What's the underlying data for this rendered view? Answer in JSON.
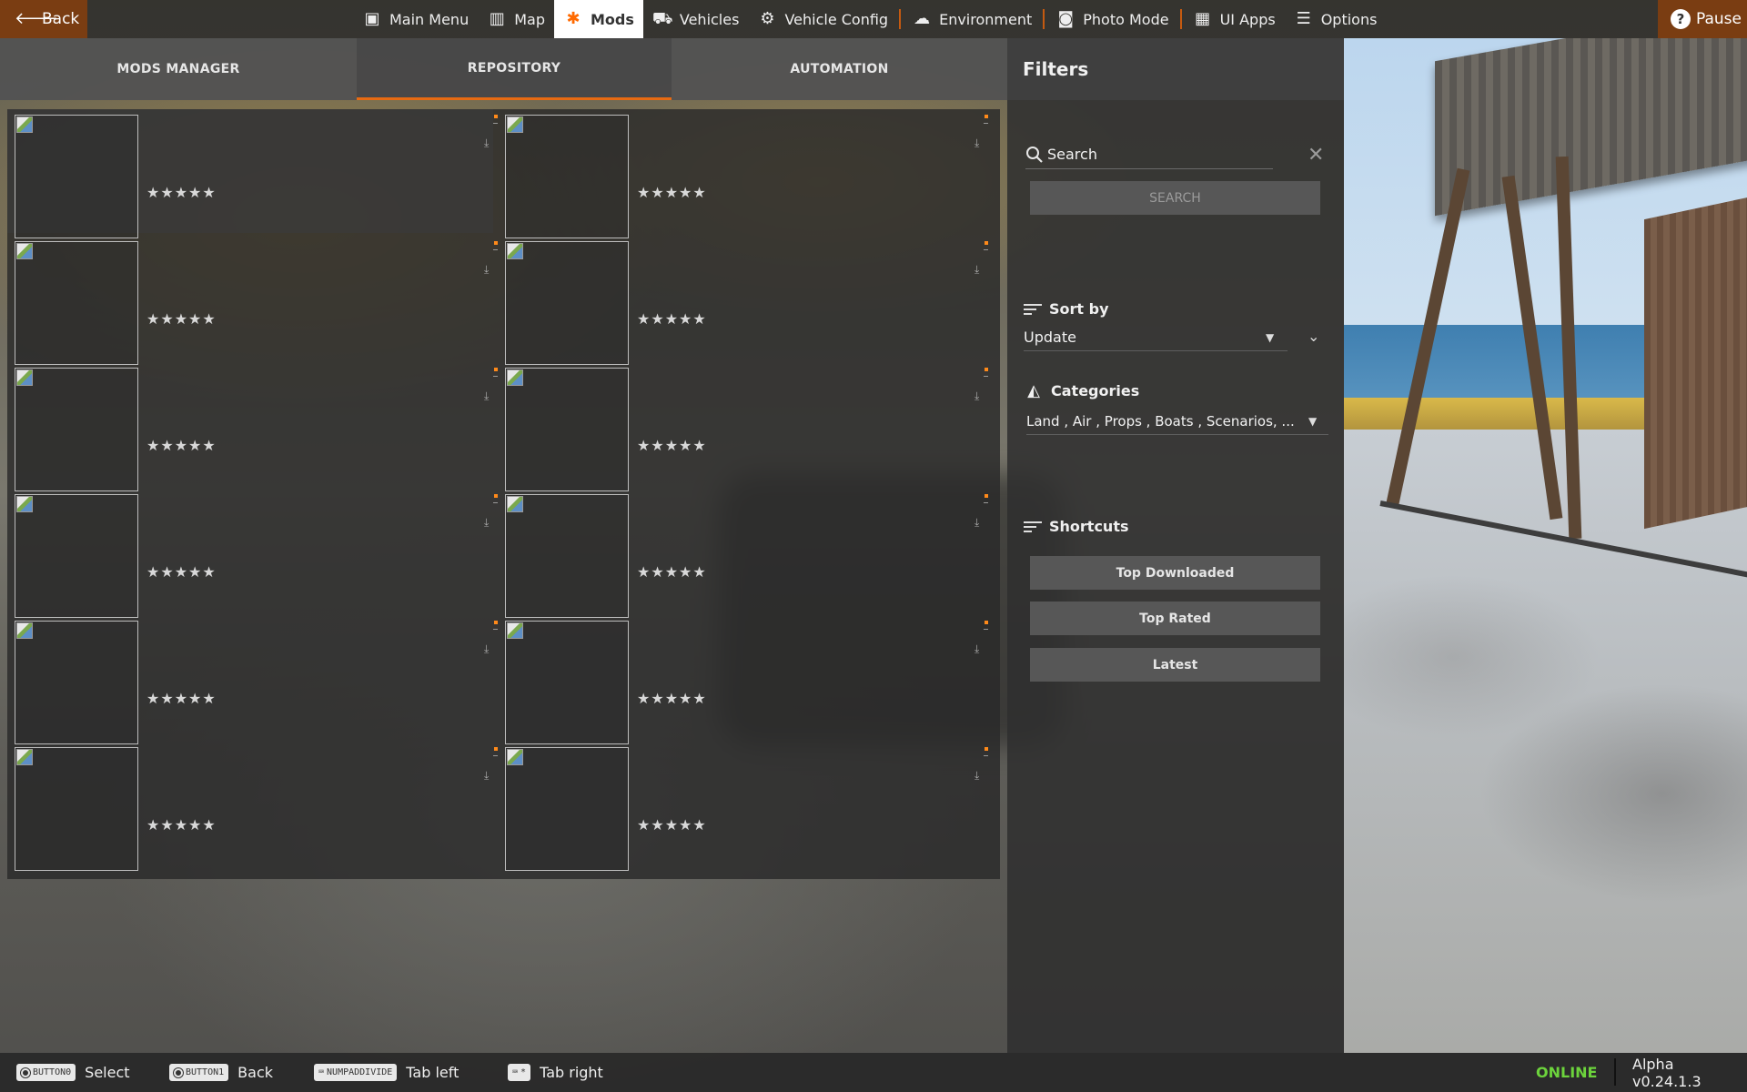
{
  "topbar": {
    "back_label": "Back",
    "pause_label": "Pause",
    "nav": [
      {
        "label": "Main Menu",
        "icon": "main-menu-icon"
      },
      {
        "label": "Map",
        "icon": "map-icon"
      },
      {
        "label": "Mods",
        "icon": "puzzle-icon",
        "active": true
      },
      {
        "label": "Vehicles",
        "icon": "car-icon"
      },
      {
        "label": "Vehicle Config",
        "icon": "engine-icon"
      },
      {
        "label": "Environment",
        "icon": "weather-icon"
      },
      {
        "label": "Photo Mode",
        "icon": "camera-icon"
      },
      {
        "label": "UI Apps",
        "icon": "ui-apps-icon"
      },
      {
        "label": "Options",
        "icon": "sliders-icon"
      }
    ]
  },
  "tabs": {
    "mods_manager": "MODS MANAGER",
    "repository": "REPOSITORY",
    "automation": "AUTOMATION"
  },
  "mods": {
    "rating_stars": "★★★★★",
    "download_glyph": "⤓",
    "count": 12
  },
  "filters": {
    "title": "Filters",
    "search_placeholder": "Search",
    "search_button": "SEARCH",
    "sort_title": "Sort by",
    "sort_value": "Update",
    "categories_title": "Categories",
    "categories_value": "Land , Air , Props , Boats , Scenarios, ...",
    "shortcuts_title": "Shortcuts",
    "shortcuts": [
      "Top Downloaded",
      "Top Rated",
      "Latest"
    ]
  },
  "bottombar": {
    "hints": [
      {
        "key": "BUTTON0",
        "label": "Select"
      },
      {
        "key": "BUTTON1",
        "label": "Back"
      },
      {
        "key": "NUMPADDIVIDE",
        "label": "Tab left"
      },
      {
        "key": "*",
        "label": "Tab right"
      }
    ],
    "status": "ONLINE",
    "version": "Alpha v0.24.1.3"
  },
  "colors": {
    "accent": "#e76a12",
    "back_bg": "#7a3d12",
    "online": "#6cd33c"
  }
}
